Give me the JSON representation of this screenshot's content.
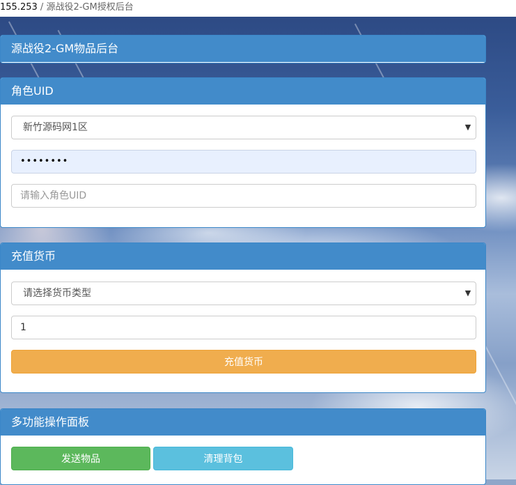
{
  "browser": {
    "host": "155.253",
    "separator": "/",
    "page_title": "源战役2-GM授权后台"
  },
  "header_panel": {
    "title": "源战役2-GM物品后台"
  },
  "role_panel": {
    "title": "角色UID",
    "server_select": {
      "value": "新竹源码网1区"
    },
    "password_field": {
      "value": "••••••••"
    },
    "uid_input": {
      "placeholder": "请输入角色UID",
      "value": ""
    }
  },
  "recharge_panel": {
    "title": "充值货币",
    "currency_select": {
      "value": "请选择货币类型"
    },
    "amount_input": {
      "value": "1"
    },
    "recharge_button": {
      "label": "充值货币"
    }
  },
  "multi_panel": {
    "title": "多功能操作面板",
    "send_items_button": {
      "label": "发送物品"
    },
    "clear_bag_button": {
      "label": "清理背包"
    }
  },
  "colors": {
    "panel_header": "#428bca",
    "warning": "#f0ad4e",
    "success": "#5cb85c",
    "info": "#5bc0de",
    "autofill": "#e8f0fe"
  },
  "icons": {
    "select_arrow": "chevron-down-icon"
  }
}
